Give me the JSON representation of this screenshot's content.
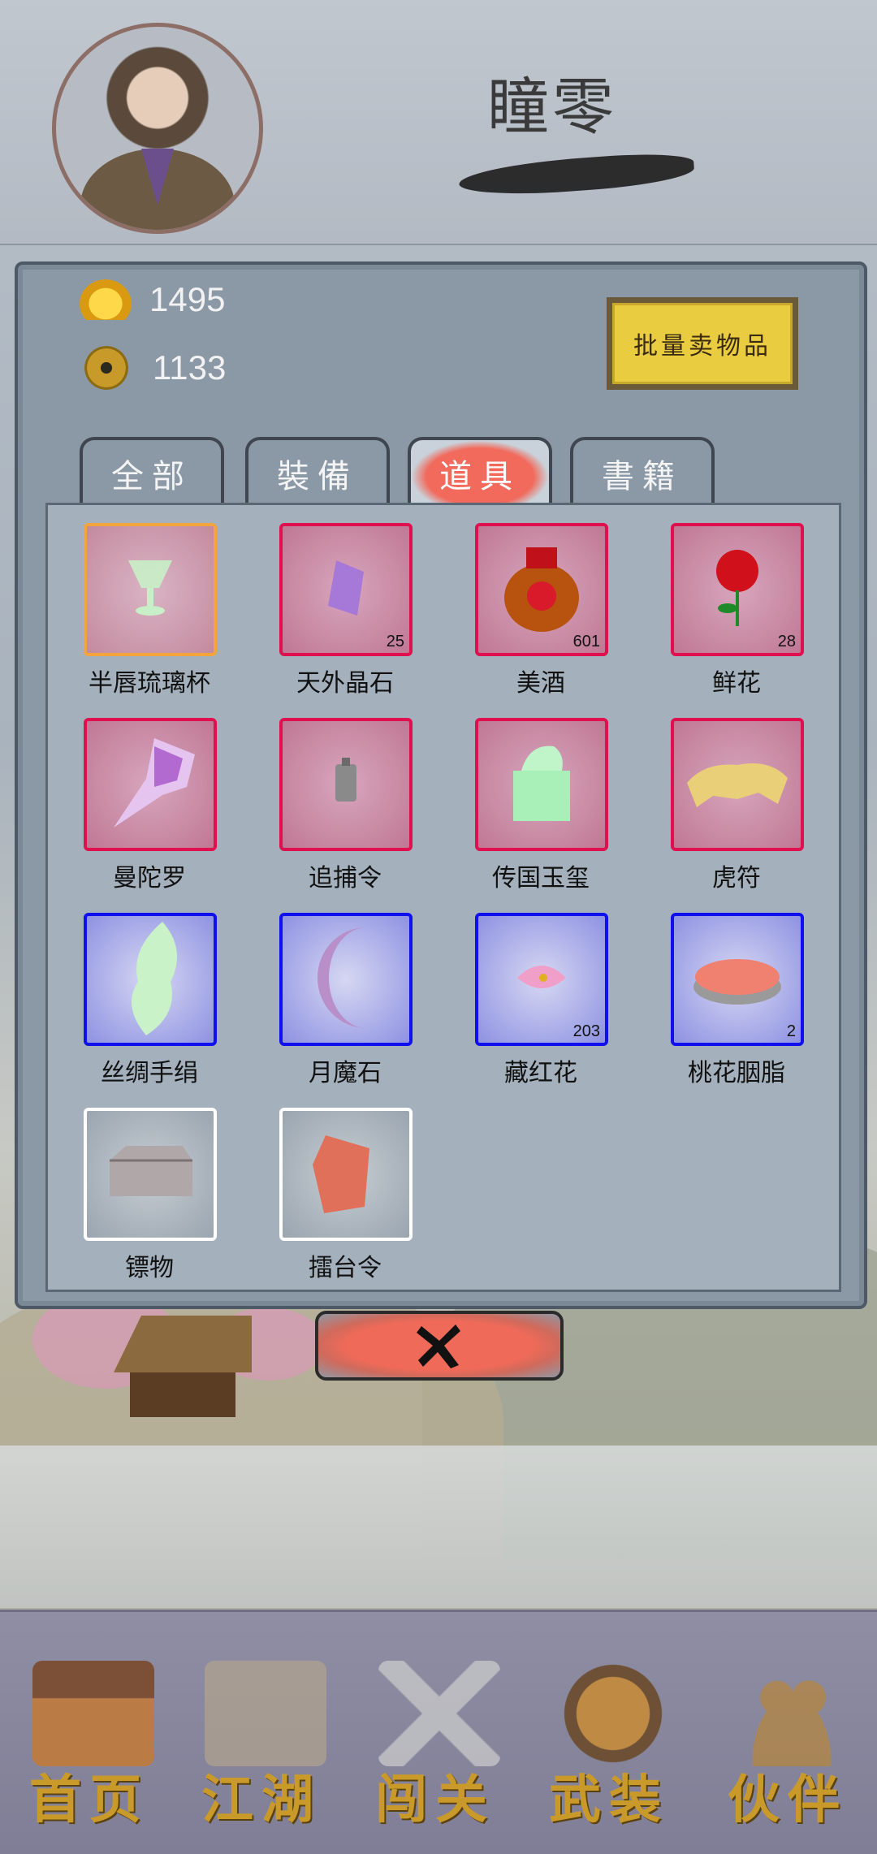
{
  "player": {
    "name": "瞳零"
  },
  "currency": {
    "gold": "1495",
    "coins": "1133"
  },
  "sell_button": "批量卖物品",
  "tabs": [
    {
      "label": "全部",
      "active": false
    },
    {
      "label": "裝備",
      "active": false
    },
    {
      "label": "道具",
      "active": true
    },
    {
      "label": "書籍",
      "active": false
    }
  ],
  "items": [
    {
      "name": "半唇琉璃杯",
      "count": "",
      "quality": "orange",
      "icon": "glass-cup-icon"
    },
    {
      "name": "天外晶石",
      "count": "25",
      "quality": "red",
      "icon": "crystal-icon"
    },
    {
      "name": "美酒",
      "count": "601",
      "quality": "red",
      "icon": "wine-jar-icon"
    },
    {
      "name": "鲜花",
      "count": "28",
      "quality": "red",
      "icon": "rose-icon"
    },
    {
      "name": "曼陀罗",
      "count": "",
      "quality": "red",
      "icon": "datura-flower-icon"
    },
    {
      "name": "追捕令",
      "count": "",
      "quality": "red",
      "icon": "arrest-token-icon"
    },
    {
      "name": "传国玉玺",
      "count": "",
      "quality": "red",
      "icon": "jade-seal-icon"
    },
    {
      "name": "虎符",
      "count": "",
      "quality": "red",
      "icon": "tiger-tally-icon"
    },
    {
      "name": "丝绸手绢",
      "count": "",
      "quality": "blue",
      "icon": "silk-handkerchief-icon"
    },
    {
      "name": "月魔石",
      "count": "",
      "quality": "blue",
      "icon": "moon-stone-icon"
    },
    {
      "name": "藏红花",
      "count": "203",
      "quality": "blue",
      "icon": "saffron-icon"
    },
    {
      "name": "桃花胭脂",
      "count": "2",
      "quality": "blue",
      "icon": "rouge-box-icon"
    },
    {
      "name": "镖物",
      "count": "",
      "quality": "white",
      "icon": "escort-box-icon"
    },
    {
      "name": "擂台令",
      "count": "",
      "quality": "white",
      "icon": "arena-token-icon"
    }
  ],
  "close_icon": "close-x-icon",
  "nav": [
    {
      "label": "首页",
      "icon": "house-icon"
    },
    {
      "label": "江湖",
      "icon": "scroll-icon"
    },
    {
      "label": "闯关",
      "icon": "crossed-swords-icon"
    },
    {
      "label": "武装",
      "icon": "armor-icon"
    },
    {
      "label": "伙伴",
      "icon": "companions-icon"
    }
  ],
  "colors": {
    "quality_orange": "#f4a43c",
    "quality_red": "#e0104f",
    "quality_blue": "#1010ee",
    "quality_white": "#ffffff",
    "active_tab": "#f26a5c",
    "sell_button": "#e9cc40"
  }
}
